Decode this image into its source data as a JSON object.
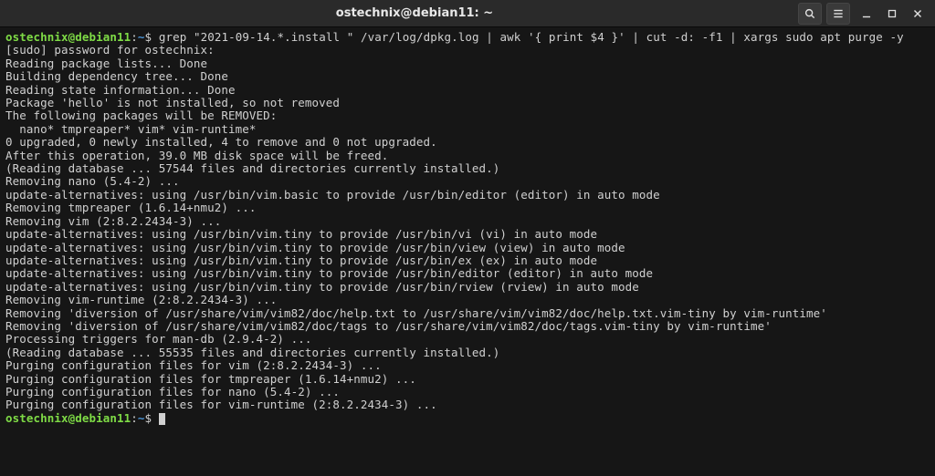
{
  "titlebar": {
    "title": "ostechnix@debian11: ~"
  },
  "prompt": {
    "userhost": "ostechnix@debian11",
    "sep": ":",
    "path": "~",
    "marker": "$ "
  },
  "command": "grep \"2021-09-14.*.install \" /var/log/dpkg.log | awk '{ print $4 }' | cut -d: -f1 | xargs sudo apt purge -y",
  "output": [
    "[sudo] password for ostechnix:",
    "Reading package lists... Done",
    "Building dependency tree... Done",
    "Reading state information... Done",
    "Package 'hello' is not installed, so not removed",
    "The following packages will be REMOVED:",
    "  nano* tmpreaper* vim* vim-runtime*",
    "0 upgraded, 0 newly installed, 4 to remove and 0 not upgraded.",
    "After this operation, 39.0 MB disk space will be freed.",
    "(Reading database ... 57544 files and directories currently installed.)",
    "Removing nano (5.4-2) ...",
    "update-alternatives: using /usr/bin/vim.basic to provide /usr/bin/editor (editor) in auto mode",
    "Removing tmpreaper (1.6.14+nmu2) ...",
    "Removing vim (2:8.2.2434-3) ...",
    "update-alternatives: using /usr/bin/vim.tiny to provide /usr/bin/vi (vi) in auto mode",
    "update-alternatives: using /usr/bin/vim.tiny to provide /usr/bin/view (view) in auto mode",
    "update-alternatives: using /usr/bin/vim.tiny to provide /usr/bin/ex (ex) in auto mode",
    "update-alternatives: using /usr/bin/vim.tiny to provide /usr/bin/editor (editor) in auto mode",
    "update-alternatives: using /usr/bin/vim.tiny to provide /usr/bin/rview (rview) in auto mode",
    "Removing vim-runtime (2:8.2.2434-3) ...",
    "Removing 'diversion of /usr/share/vim/vim82/doc/help.txt to /usr/share/vim/vim82/doc/help.txt.vim-tiny by vim-runtime'",
    "Removing 'diversion of /usr/share/vim/vim82/doc/tags to /usr/share/vim/vim82/doc/tags.vim-tiny by vim-runtime'",
    "Processing triggers for man-db (2.9.4-2) ...",
    "(Reading database ... 55535 files and directories currently installed.)",
    "Purging configuration files for vim (2:8.2.2434-3) ...",
    "Purging configuration files for tmpreaper (1.6.14+nmu2) ...",
    "Purging configuration files for nano (5.4-2) ...",
    "Purging configuration files for vim-runtime (2:8.2.2434-3) ..."
  ]
}
